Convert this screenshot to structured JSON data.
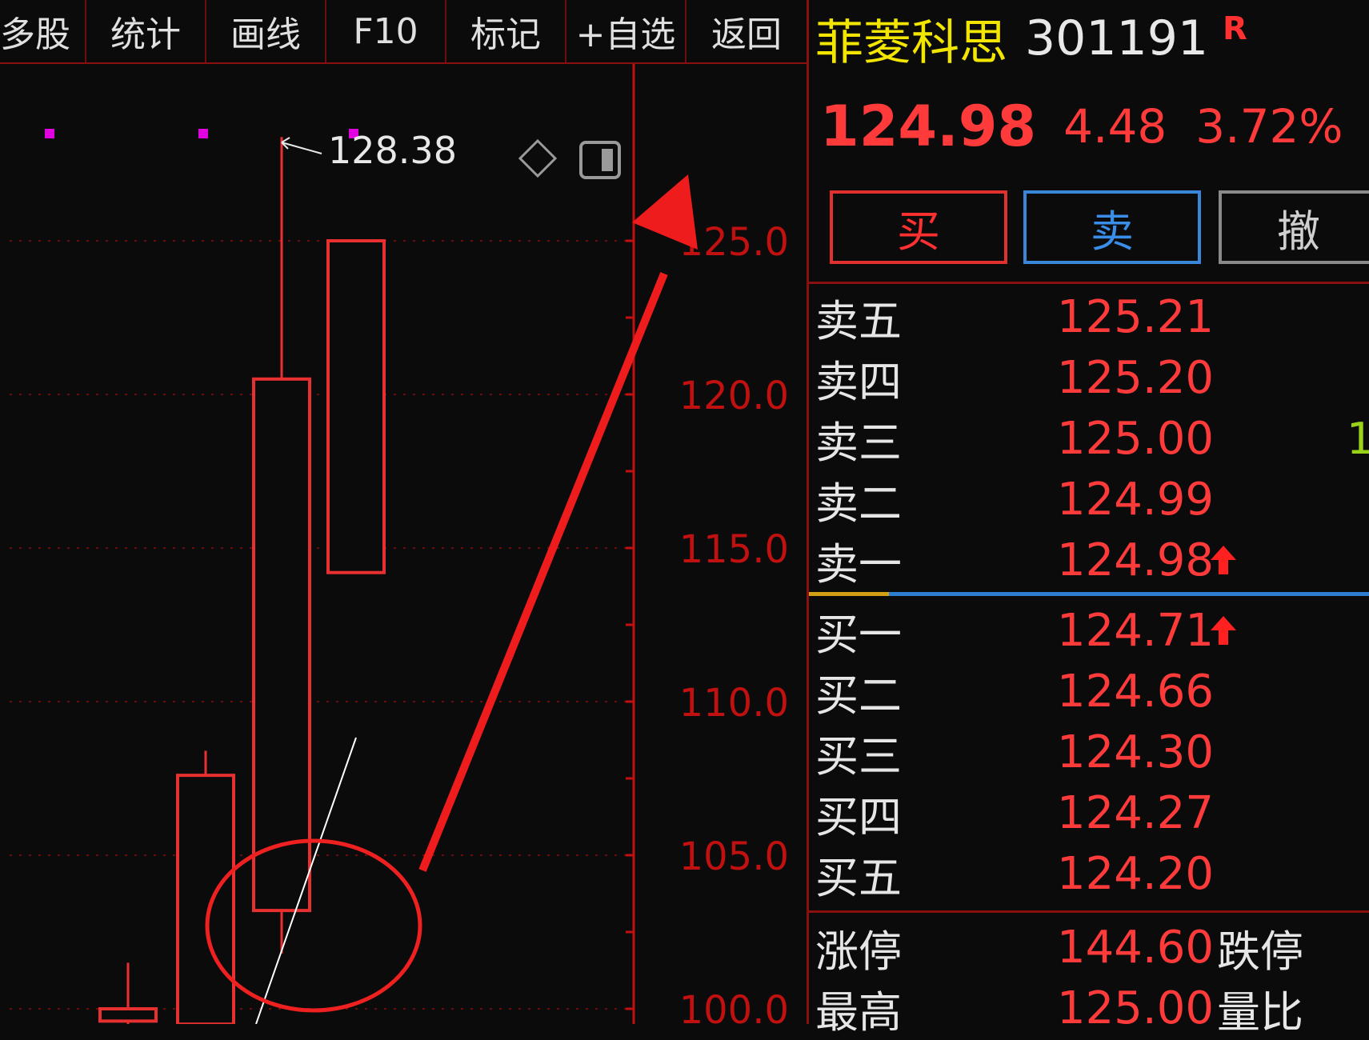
{
  "toolbar": [
    {
      "label": "多股"
    },
    {
      "label": "统计"
    },
    {
      "label": "画线"
    },
    {
      "label": "F10"
    },
    {
      "label": "标记"
    },
    {
      "label": "+自选"
    },
    {
      "label": "返回"
    }
  ],
  "chart": {
    "high_annotation": "128.38",
    "y_ticks": [
      "125.0",
      "120.0",
      "115.0",
      "110.0",
      "105.0",
      "100.0"
    ],
    "colors": {
      "up": "#e83030",
      "axis": "#c01010",
      "annotation": "#ff2020",
      "marker": "#e000e0"
    }
  },
  "chart_data": {
    "type": "candlestick",
    "ylim": [
      99.5,
      130
    ],
    "y_ticks": [
      125,
      120,
      115,
      110,
      105,
      100
    ],
    "candles": [
      {
        "open": 99.6,
        "close": 100.0,
        "high": 101.5,
        "low": 99.5
      },
      {
        "open": 99.5,
        "close": 107.6,
        "high": 108.4,
        "low": 99.5
      },
      {
        "open": 103.2,
        "close": 120.5,
        "high": 128.38,
        "low": 101.8
      },
      {
        "open": 114.2,
        "close": 125.0,
        "high": 125.0,
        "low": 114.2
      }
    ],
    "annotation": {
      "label": "128.38",
      "value": 128.38
    }
  },
  "quote": {
    "name": "菲菱科思",
    "code": "301191",
    "badge": "R",
    "last": "124.98",
    "change": "4.48",
    "change_pct": "3.72%",
    "buttons": {
      "buy": "买",
      "sell": "卖",
      "cancel": "撤"
    },
    "asks": [
      {
        "label": "卖五",
        "price": "125.21"
      },
      {
        "label": "卖四",
        "price": "125.20"
      },
      {
        "label": "卖三",
        "price": "125.00",
        "extra": "1"
      },
      {
        "label": "卖二",
        "price": "124.99"
      },
      {
        "label": "卖一",
        "price": "124.98",
        "arrow": true
      }
    ],
    "bids": [
      {
        "label": "买一",
        "price": "124.71",
        "arrow": true
      },
      {
        "label": "买二",
        "price": "124.66"
      },
      {
        "label": "买三",
        "price": "124.30"
      },
      {
        "label": "买四",
        "price": "124.27"
      },
      {
        "label": "买五",
        "price": "124.20"
      }
    ],
    "limit_up_label": "涨停",
    "limit_up": "144.60",
    "limit_down_label": "跌停",
    "high_label": "最高",
    "high": "125.00",
    "ratio_label": "量比"
  }
}
